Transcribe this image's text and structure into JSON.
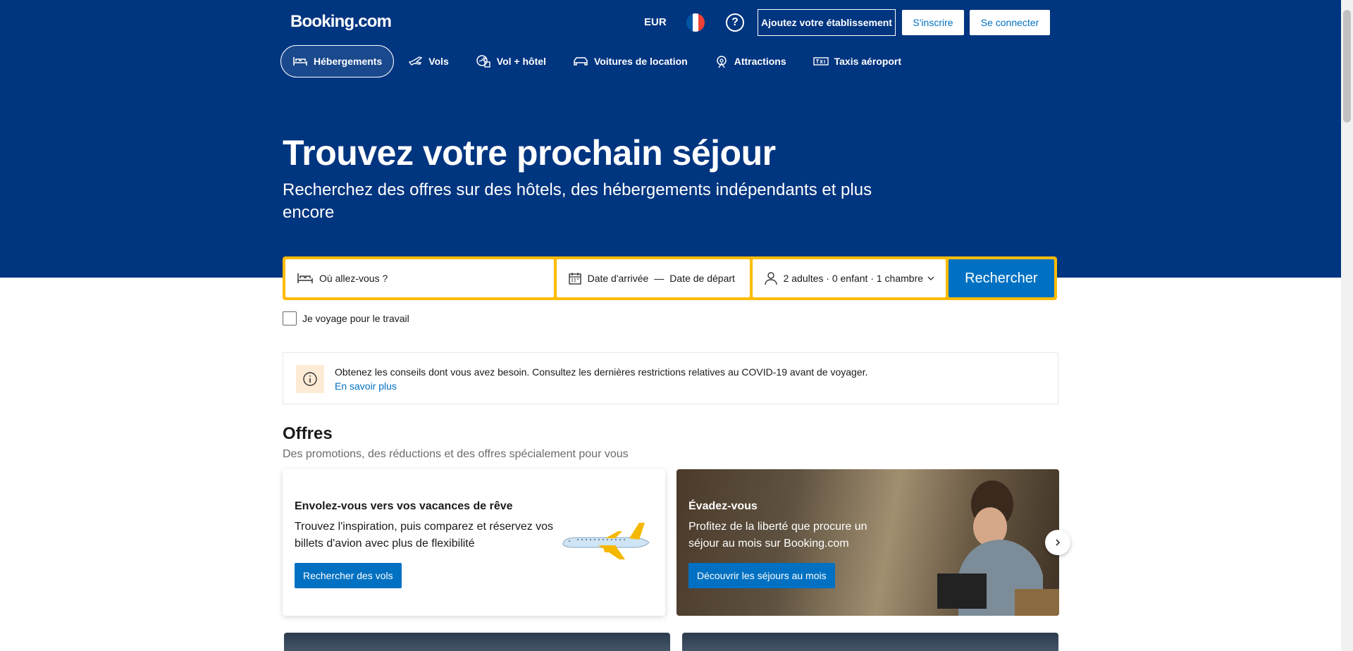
{
  "header": {
    "logo": "Booking.com",
    "currency": "EUR",
    "list_property": "Ajoutez votre établissement",
    "register": "S'inscrire",
    "sign_in": "Se connecter"
  },
  "nav": {
    "items": [
      {
        "label": "Hébergements",
        "icon": "bed-icon",
        "active": true
      },
      {
        "label": "Vols",
        "icon": "plane-icon"
      },
      {
        "label": "Vol + hôtel",
        "icon": "flight-hotel-icon"
      },
      {
        "label": "Voitures de location",
        "icon": "car-icon"
      },
      {
        "label": "Attractions",
        "icon": "attractions-icon"
      },
      {
        "label": "Taxis aéroport",
        "icon": "taxi-icon"
      }
    ]
  },
  "hero": {
    "title": "Trouvez votre prochain séjour",
    "subtitle": "Recherchez des offres sur des hôtels, des hébergements indépendants et plus encore"
  },
  "search": {
    "destination_placeholder": "Où allez-vous ?",
    "checkin": "Date d'arrivée",
    "separator": "—",
    "checkout": "Date de départ",
    "guests": "2 adultes · 0 enfant · 1 chambre",
    "submit": "Rechercher",
    "work_trip": "Je voyage pour le travail"
  },
  "notice": {
    "text": "Obtenez les conseils dont vous avez besoin. Consultez les dernières restrictions relatives au COVID-19 avant de voyager. ",
    "link": "En savoir plus"
  },
  "offers": {
    "title": "Offres",
    "subtitle": "Des promotions, des réductions et des offres spécialement pour vous",
    "cards": [
      {
        "title": "Envolez-vous vers vos vacances de rêve",
        "text": "Trouvez l'inspiration, puis comparez et réservez vos billets d'avion avec plus de flexibilité",
        "button": "Rechercher des vols"
      },
      {
        "title": "Évadez-vous",
        "text": "Profitez de la liberté que procure un séjour au mois sur Booking.com",
        "button": "Découvrir les séjours au mois"
      }
    ]
  },
  "colors": {
    "brand_blue": "#003580",
    "action_blue": "#0071c2",
    "search_border": "#febb02"
  }
}
